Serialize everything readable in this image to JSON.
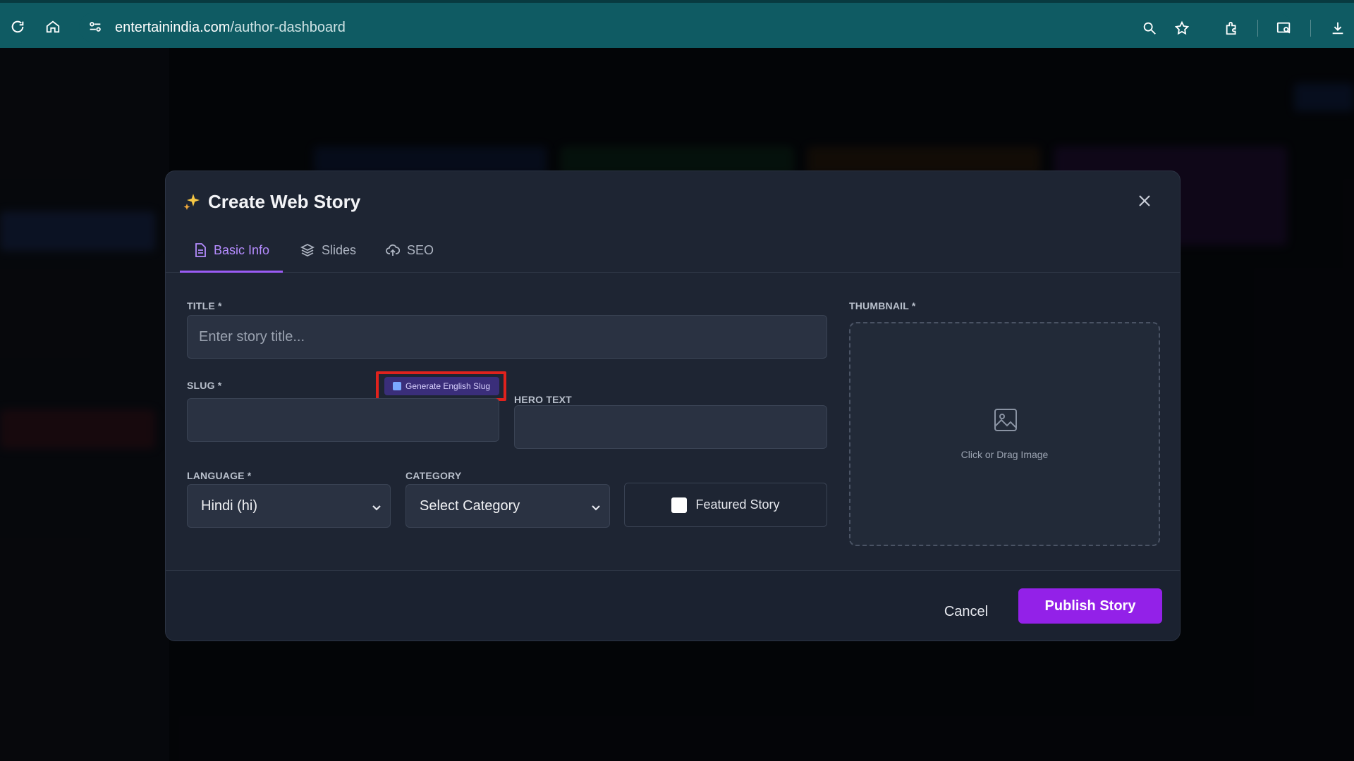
{
  "browser": {
    "url_domain": "entertainindia.com",
    "url_path": "/author-dashboard"
  },
  "modal": {
    "title": "Create Web Story",
    "tabs": [
      {
        "label": "Basic Info",
        "icon": "document-icon",
        "active": true
      },
      {
        "label": "Slides",
        "icon": "layers-icon",
        "active": false
      },
      {
        "label": "SEO",
        "icon": "cloud-upload-icon",
        "active": false
      }
    ],
    "fields": {
      "title_label": "TITLE *",
      "title_placeholder": "Enter story title...",
      "slug_label": "SLUG *",
      "slug_value": "",
      "generate_slug_button": "Generate English Slug",
      "hero_text_label": "HERO TEXT",
      "hero_text_value": "",
      "language_label": "LANGUAGE *",
      "language_selected": "Hindi (hi)",
      "category_label": "CATEGORY",
      "category_selected": "Select Category",
      "featured_label": "Featured Story",
      "featured_checked": false,
      "thumbnail_label": "THUMBNAIL *",
      "thumbnail_hint": "Click or Drag Image"
    },
    "footer": {
      "cancel_label": "Cancel",
      "publish_label": "Publish Story"
    }
  },
  "colors": {
    "browser_bar": "#0f5b63",
    "modal_bg": "#1e2533",
    "accent_purple": "#9321e8",
    "active_tab": "#b58cff",
    "highlight_red": "#e0221d"
  }
}
